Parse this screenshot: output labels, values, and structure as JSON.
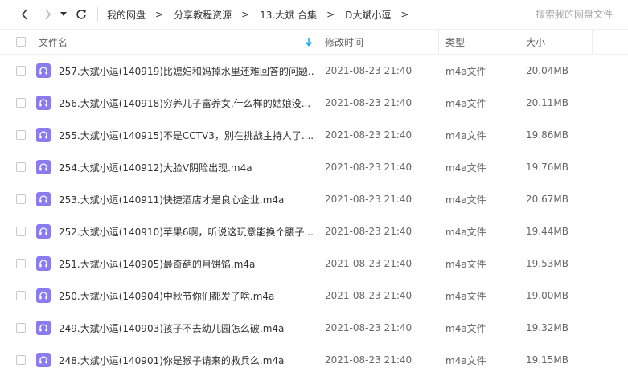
{
  "toolbar": {
    "back_icon": "chevron-left-icon",
    "forward_icon": "chevron-right-icon",
    "dropdown_icon": "caret-down-icon",
    "refresh_icon": "refresh-icon",
    "breadcrumb": [
      "我的网盘",
      "分享教程资源",
      "13.大斌 合集",
      "D大斌小逗"
    ],
    "breadcrumb_separator": ">",
    "search_placeholder": "搜索我的网盘文件"
  },
  "header": {
    "name": "文件名",
    "modified": "修改时间",
    "type": "类型",
    "size": "大小",
    "sort_icon": "sort-down-arrow-icon"
  },
  "colors": {
    "accent": "#06a7ff",
    "file_icon_bg": "#8a7cf0"
  },
  "files": [
    {
      "name": "257.大斌小逗(140919)比媳妇和妈掉水里还难回答的问题...",
      "date": "2021-08-23 21:40",
      "type": "m4a文件",
      "size": "20.04MB",
      "icon": "audio-file-icon"
    },
    {
      "name": "256.大斌小逗(140918)穷养儿子富养女,什么样的姑娘没...",
      "date": "2021-08-23 21:40",
      "type": "m4a文件",
      "size": "20.11MB",
      "icon": "audio-file-icon"
    },
    {
      "name": "255.大斌小逗(140915)不是CCTV3，別在挑战主持人了....",
      "date": "2021-08-23 21:40",
      "type": "m4a文件",
      "size": "19.86MB",
      "icon": "audio-file-icon"
    },
    {
      "name": "254.大斌小逗(140912)大脸V阴险出现.m4a",
      "date": "2021-08-23 21:40",
      "type": "m4a文件",
      "size": "19.76MB",
      "icon": "audio-file-icon"
    },
    {
      "name": "253.大斌小逗(140911)快捷酒店才是良心企业.m4a",
      "date": "2021-08-23 21:40",
      "type": "m4a文件",
      "size": "20.67MB",
      "icon": "audio-file-icon"
    },
    {
      "name": "252.大斌小逗(140910)苹果6啊，听说这玩意能换个腰子....",
      "date": "2021-08-23 21:40",
      "type": "m4a文件",
      "size": "19.44MB",
      "icon": "audio-file-icon"
    },
    {
      "name": "251.大斌小逗(140905)最奇葩的月饼馅.m4a",
      "date": "2021-08-23 21:40",
      "type": "m4a文件",
      "size": "19.53MB",
      "icon": "audio-file-icon"
    },
    {
      "name": "250.大斌小逗(140904)中秋节你们都发了啥.m4a",
      "date": "2021-08-23 21:40",
      "type": "m4a文件",
      "size": "19.00MB",
      "icon": "audio-file-icon"
    },
    {
      "name": "249.大斌小逗(140903)孩子不去幼儿园怎么破.m4a",
      "date": "2021-08-23 21:40",
      "type": "m4a文件",
      "size": "19.32MB",
      "icon": "audio-file-icon"
    },
    {
      "name": "248.大斌小逗(140901)你是猴子请来的救兵么.m4a",
      "date": "2021-08-23 21:40",
      "type": "m4a文件",
      "size": "19.15MB",
      "icon": "audio-file-icon"
    }
  ]
}
